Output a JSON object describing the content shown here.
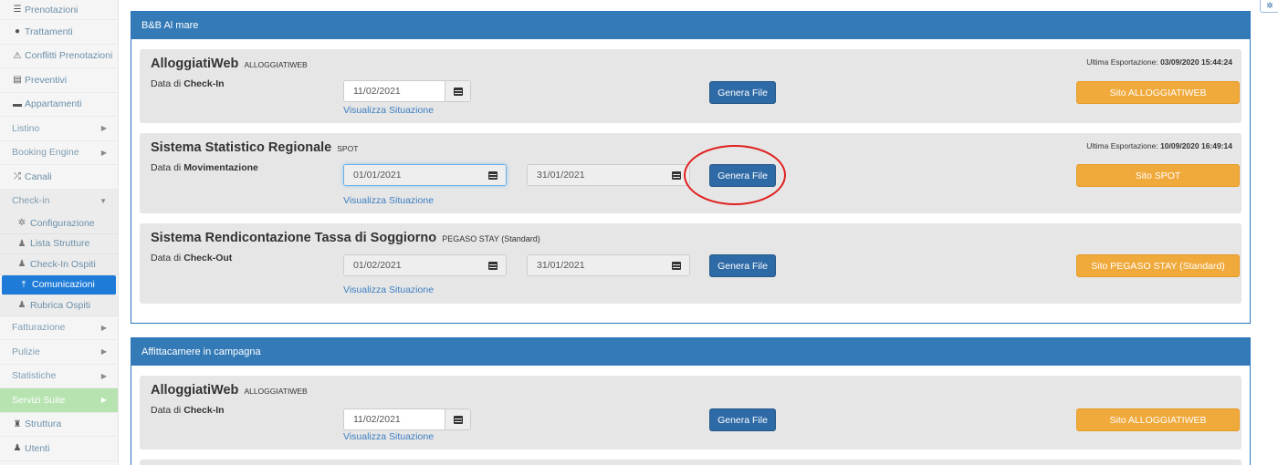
{
  "sidebar": {
    "items": [
      {
        "label": "Prenotazioni",
        "icon": "list-icon"
      },
      {
        "label": "Trattamenti",
        "icon": "apple-icon"
      },
      {
        "label": "Conflitti Prenotazioni",
        "icon": "warning-icon"
      },
      {
        "label": "Preventivi",
        "icon": "document-icon"
      },
      {
        "label": "Appartamenti",
        "icon": "bed-icon"
      },
      {
        "label": "Listino"
      },
      {
        "label": "Booking Engine"
      },
      {
        "label": "Canali",
        "icon": "shuffle-icon"
      },
      {
        "label": "Check-in"
      }
    ],
    "checkin_sub": [
      {
        "label": "Configurazione",
        "icon": "gear-icon"
      },
      {
        "label": "Lista Strutture",
        "icon": "user-icon"
      },
      {
        "label": "Check-In Ospiti",
        "icon": "user-icon"
      },
      {
        "label": "Comunicazioni",
        "icon": "upload-icon"
      },
      {
        "label": "Rubrica Ospiti",
        "icon": "user-icon"
      }
    ],
    "items_after": [
      {
        "label": "Fatturazione"
      },
      {
        "label": "Pulizie"
      },
      {
        "label": "Statistiche"
      },
      {
        "label": "Servizi Suite"
      },
      {
        "label": "Struttura",
        "icon": "castle-icon"
      },
      {
        "label": "Utenti",
        "icon": "user-icon"
      }
    ]
  },
  "panels": [
    {
      "title": "B&B Al mare",
      "cards": [
        {
          "name": "AlloggiatiWeb",
          "tag": "ALLOGGIATIWEB",
          "label_prefix": "Data di ",
          "label_bold": "Check-In",
          "last_export_label": "Ultima Esportazione: ",
          "last_export_value": "03/09/2020 15:44:24",
          "date1": "11/02/2021",
          "link": "Visualizza Situazione",
          "generate": "Genera File",
          "site": "Sito ALLOGGIATIWEB"
        },
        {
          "name": "Sistema Statistico Regionale",
          "tag": "SPOT",
          "label_prefix": "Data di ",
          "label_bold": "Movimentazione",
          "last_export_label": "Ultima Esportazione: ",
          "last_export_value": "10/09/2020 16:49:14",
          "date1": "01/01/2021",
          "date2": "31/01/2021",
          "link": "Visualizza Situazione",
          "generate": "Genera File",
          "site": "Sito SPOT"
        },
        {
          "name": "Sistema Rendicontazione Tassa di Soggiorno",
          "tag": "PEGASO STAY (Standard)",
          "label_prefix": "Data di ",
          "label_bold": "Check-Out",
          "date1": "01/02/2021",
          "date2": "31/01/2021",
          "link": "Visualizza Situazione",
          "generate": "Genera File",
          "site": "Sito PEGASO STAY (Standard)"
        }
      ]
    },
    {
      "title": "Affittacamere in campagna",
      "cards": [
        {
          "name": "AlloggiatiWeb",
          "tag": "ALLOGGIATIWEB",
          "label_prefix": "Data di ",
          "label_bold": "Check-In",
          "date1": "11/02/2021",
          "link": "Visualizza Situazione",
          "generate": "Genera File",
          "site": "Sito ALLOGGIATIWEB"
        }
      ]
    }
  ],
  "colors": {
    "primary": "#337ab7",
    "button_blue": "#2e6aa6",
    "button_orange": "#f0a93b",
    "active_nav": "#1f7bd8",
    "services_green": "#b6e3b0",
    "highlight_ring": "#e0201f"
  }
}
